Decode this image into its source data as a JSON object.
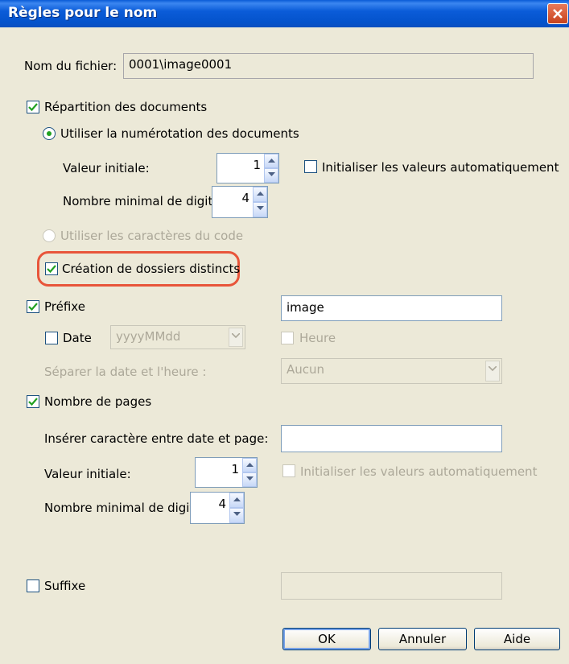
{
  "window": {
    "title": "Règles pour le nom"
  },
  "filename": {
    "label": "Nom du fichier:",
    "value": "0001\\image0001"
  },
  "doc_split": {
    "label": "Répartition des documents",
    "checked": true,
    "use_numbering": {
      "label": "Utiliser la numérotation des documents",
      "selected": true
    },
    "initial_value": {
      "label": "Valeur initiale:",
      "value": "1"
    },
    "auto_init": {
      "label": "Initialiser les valeurs automatiquement",
      "checked": false
    },
    "min_digits": {
      "label": "Nombre minimal de digits:",
      "value": "4"
    },
    "use_code_chars": {
      "label": "Utiliser les caractères du code",
      "selected": false
    },
    "separate_folders": {
      "label": "Création de dossiers distincts",
      "checked": true
    }
  },
  "prefix": {
    "label": "Préfixe",
    "checked": true,
    "value": "image"
  },
  "date": {
    "label": "Date",
    "checked": false,
    "format": "yyyyMMdd"
  },
  "time": {
    "label": "Heure",
    "checked": false
  },
  "separator": {
    "label": "Séparer la date et l'heure :",
    "value": "Aucun"
  },
  "pages": {
    "label": "Nombre de pages",
    "checked": true,
    "insert_char": {
      "label": "Insérer caractère entre date et page:",
      "value": ""
    },
    "initial_value": {
      "label": "Valeur initiale:",
      "value": "1"
    },
    "auto_init": {
      "label": "Initialiser les valeurs automatiquement",
      "checked": false
    },
    "min_digits": {
      "label": "Nombre minimal de digits:",
      "value": "4"
    }
  },
  "suffix": {
    "label": "Suffixe",
    "checked": false,
    "value": ""
  },
  "buttons": {
    "ok": "OK",
    "cancel": "Annuler",
    "help": "Aide"
  },
  "colors": {
    "titlebar": "#0453cc",
    "dialog_bg": "#ece9d8",
    "highlight": "#e8553a",
    "check": "#21a121"
  }
}
